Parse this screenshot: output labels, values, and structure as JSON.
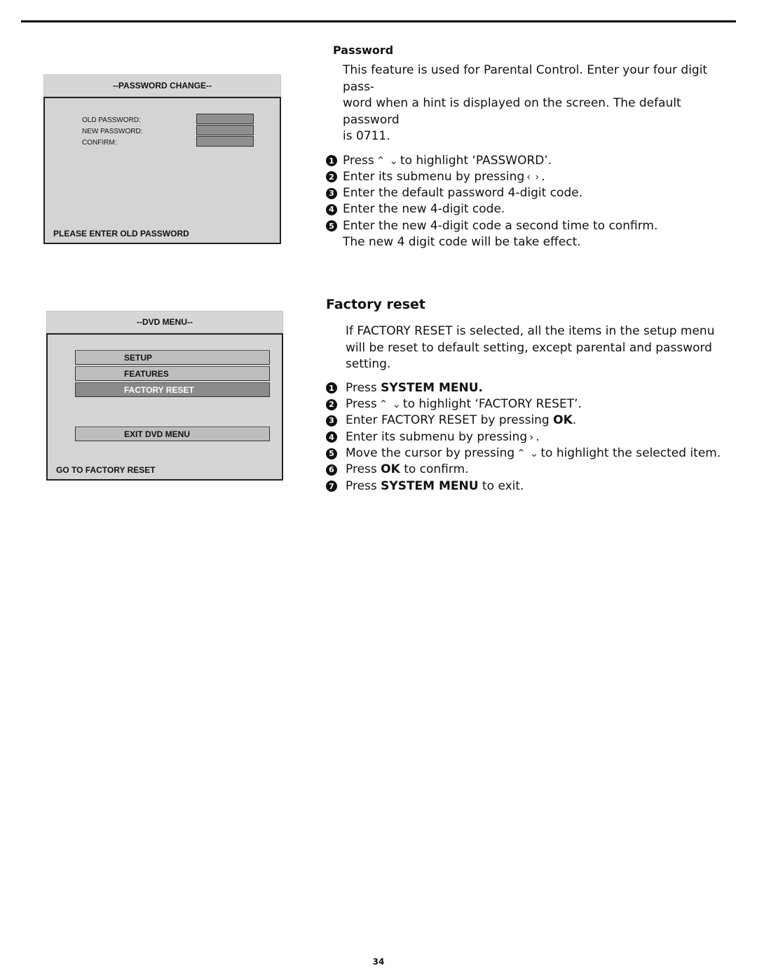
{
  "password_screen": {
    "title": "--PASSWORD CHANGE--",
    "fields": [
      {
        "label": "OLD PASSWORD:",
        "value": ""
      },
      {
        "label": "NEW PASSWORD:",
        "value": ""
      },
      {
        "label": "CONFIRM:",
        "value": ""
      }
    ],
    "status": "PLEASE ENTER OLD PASSWORD"
  },
  "dvd_menu_screen": {
    "title": "--DVD MENU--",
    "items": [
      {
        "label": "SETUP",
        "selected": false
      },
      {
        "label": "FEATURES",
        "selected": false
      },
      {
        "label": "FACTORY RESET",
        "selected": true
      }
    ],
    "exit_label": "EXIT DVD MENU",
    "status": "GO TO FACTORY RESET"
  },
  "password_section": {
    "heading": "Password",
    "intro": "This feature is used for Parental Control. Enter your four digit pass-word when a hint is displayed on the screen. The default password is 0711.",
    "intro_lines": [
      "This feature is used for Parental Control. Enter your four digit pass-",
      "word when a hint is displayed on the screen. The default password",
      "is 0711."
    ],
    "steps": [
      {
        "num": "1",
        "pre": "Press",
        "icon": "up-down-arrows",
        "post": "to highlight ‘PASSWORD’."
      },
      {
        "num": "2",
        "pre": "Enter its submenu by pressing",
        "icon": "left-right-arrows",
        "post": "."
      },
      {
        "num": "3",
        "pre": "Enter the default password 4-digit code.",
        "icon": "",
        "post": ""
      },
      {
        "num": "4",
        "pre": "Enter the new 4-digit code.",
        "icon": "",
        "post": ""
      },
      {
        "num": "5",
        "pre": "Enter the new 4-digit code a second time to confirm.",
        "icon": "",
        "post": ""
      }
    ],
    "note": "The new 4 digit code will be take effect."
  },
  "factory_section": {
    "heading": "Factory reset",
    "intro_lines": [
      "If FACTORY RESET is selected, all the items in the setup menu",
      "will be reset to default setting, except parental and password",
      "setting."
    ],
    "steps": [
      {
        "num": "1",
        "pre": "Press",
        "bold": "SYSTEM MENU.",
        "post": ""
      },
      {
        "num": "2",
        "pre": "Press",
        "icon": "up-down-arrows",
        "post": "to highlight ‘FACTORY RESET’."
      },
      {
        "num": "3",
        "pre": "Enter FACTORY RESET by pressing",
        "bold": "OK",
        "post": "."
      },
      {
        "num": "4",
        "pre": "Enter its submenu by pressing",
        "icon": "right-arrow",
        "post": "."
      },
      {
        "num": "5",
        "pre": "Move the cursor by pressing",
        "icon": "up-down-arrows",
        "post": "to highlight the selected item."
      },
      {
        "num": "6",
        "pre": "Press",
        "bold": "OK",
        "post": "to confirm."
      },
      {
        "num": "7",
        "pre": "Press",
        "bold": "SYSTEM MENU",
        "post": "to exit."
      }
    ]
  },
  "icons": {
    "up": "⌃",
    "down": "⌄",
    "left": "‹",
    "right": "›"
  },
  "page_number": "34"
}
